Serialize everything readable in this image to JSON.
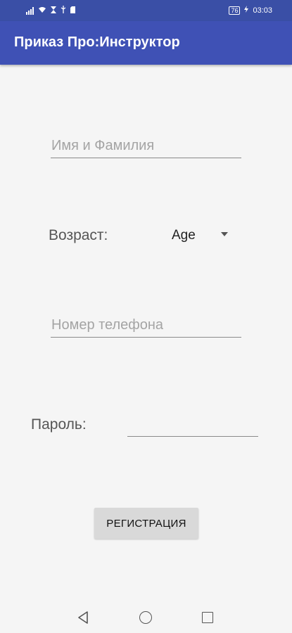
{
  "status_bar": {
    "battery": "76",
    "time": "03:03"
  },
  "app_bar": {
    "title": "Приказ Про:Инструктор"
  },
  "form": {
    "name_field": {
      "placeholder": "Имя и Фамилия",
      "value": ""
    },
    "age_label": "Возраст:",
    "age_spinner": {
      "selected": "Age"
    },
    "phone_field": {
      "placeholder": "Номер телефона",
      "value": ""
    },
    "password_label": "Пароль:",
    "password_field": {
      "value": ""
    },
    "register_button": "РЕГИСТРАЦИЯ"
  },
  "colors": {
    "app_bar": "#3f51b5",
    "status_bar": "#3a4fa6",
    "background": "#f5f5f5",
    "button": "#d9d9d9"
  }
}
